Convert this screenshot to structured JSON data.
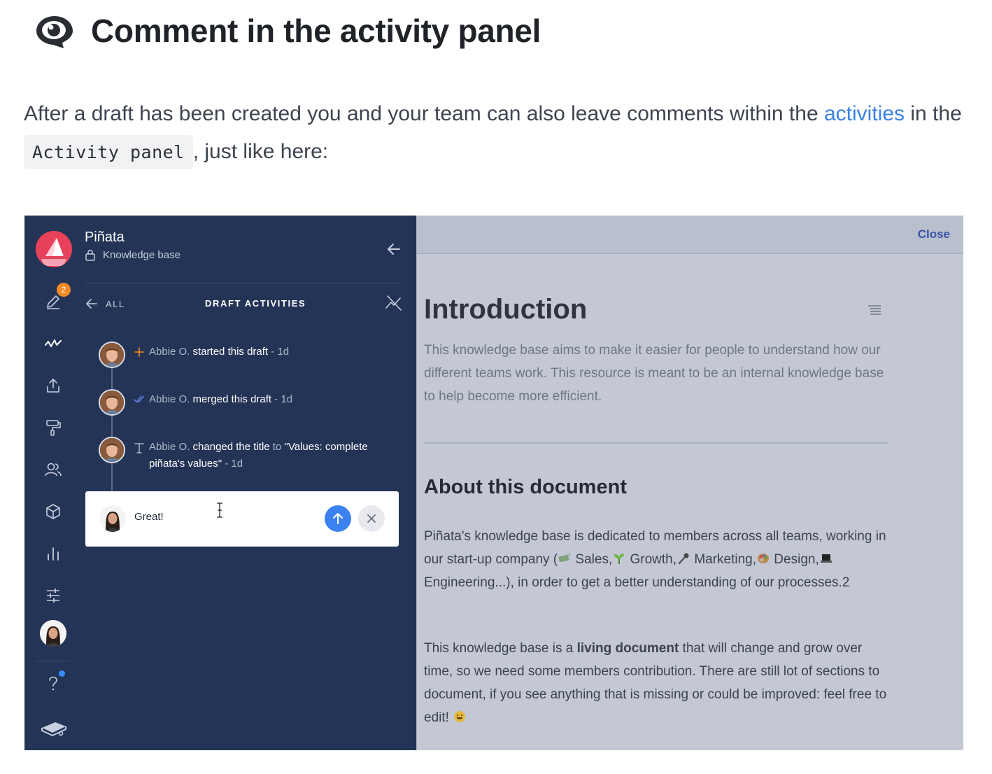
{
  "heading": {
    "title": "Comment in the activity panel",
    "icon": "eye-speech-icon"
  },
  "intro": {
    "before_link": "After a draft has been created you and your team can also leave comments within the ",
    "link_text": "activities",
    "middle": " in the ",
    "code": "Activity panel",
    "after": ", just like here:",
    "link_color": "#3b82e6"
  },
  "app": {
    "workspace_name": "Piñata",
    "workspace_sub": "Knowledge base",
    "nav_badge": "2",
    "panel": {
      "back_label": "ALL",
      "title": "DRAFT ACTIVITIES"
    },
    "activities": [
      {
        "icon": "plus-icon",
        "user": "Abbie O.",
        "action": "started this draft",
        "time": " - 1d"
      },
      {
        "icon": "double-check-icon",
        "user": "Abbie O.",
        "action": "merged this draft",
        "time": " - 1d"
      },
      {
        "icon": "text-icon",
        "user": "Abbie O.",
        "action": "changed the title",
        "to": " to ",
        "value": "\"Values: complete piñata's values\"",
        "time": " - 1d"
      }
    ],
    "comment": {
      "value": "Great!"
    },
    "colors": {
      "sidebar_bg": "#233456",
      "accent_blue": "#3b82f0",
      "badge_orange": "#f08a24",
      "logo_red": "#e8415c"
    }
  },
  "document": {
    "close_label": "Close",
    "intro_title": "Introduction",
    "intro_text": "This knowledge base aims to make it easier for people to understand how our different teams work. This resource is meant to be an internal knowledge base to help become more efficient.",
    "about_title": "About this document",
    "about_p1": {
      "start": "Piñata's knowledge base is dedicated to members across all teams, working in our start-up company (",
      "sales": " Sales,",
      "growth": " Growth,",
      "marketing": " Marketing,",
      "design": " Design,",
      "engineering": " Engineering...), in order to get a better understanding of our processes.2"
    },
    "about_p2": {
      "start": "This knowledge base is a ",
      "bold": "living document",
      "end": " that will change and grow over time, so we need some members contribution. There are still lot of sections to document, if you see anything that is missing or could be improved: feel free to edit! "
    }
  }
}
